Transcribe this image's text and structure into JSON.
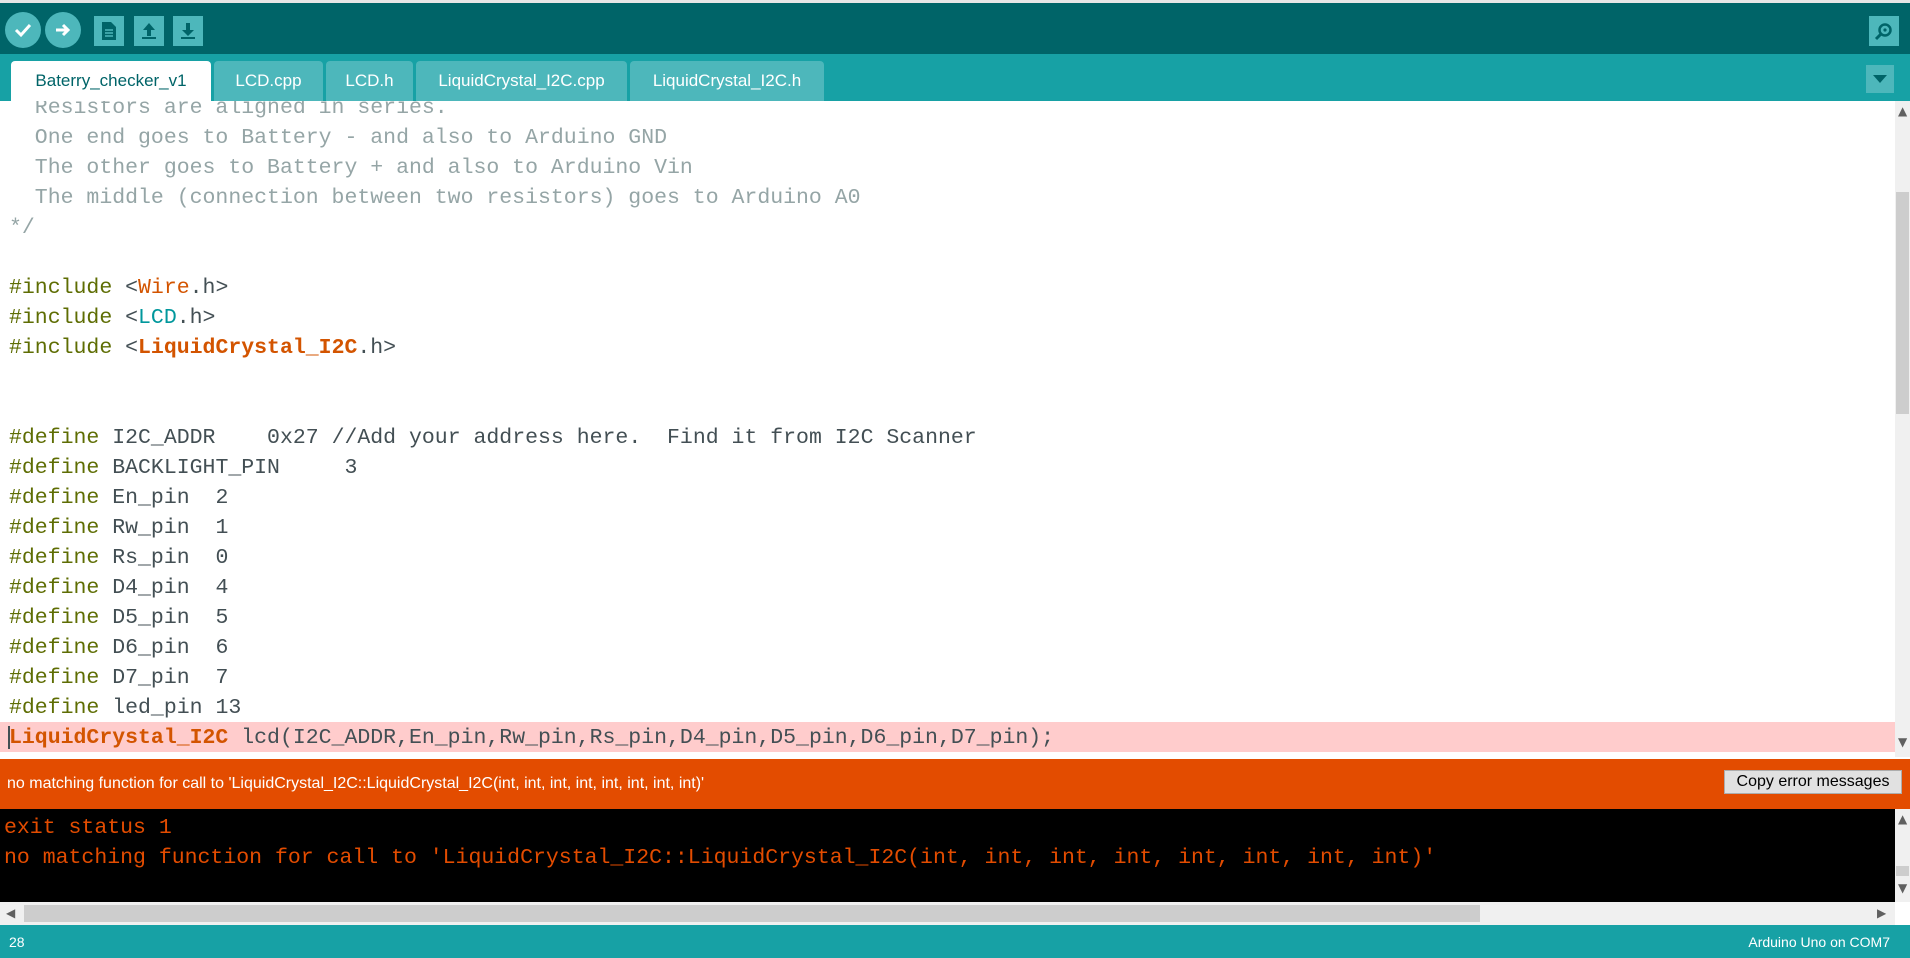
{
  "toolbar": {
    "buttons": [
      "verify-icon",
      "upload-icon",
      "new-icon",
      "open-icon",
      "save-icon",
      "serial-monitor-icon"
    ]
  },
  "tabs": [
    {
      "label": "Baterry_checker_v1",
      "active": true
    },
    {
      "label": "LCD.cpp",
      "active": false
    },
    {
      "label": "LCD.h",
      "active": false
    },
    {
      "label": "LiquidCrystal_I2C.cpp",
      "active": false
    },
    {
      "label": "LiquidCrystal_I2C.h",
      "active": false
    }
  ],
  "editor": {
    "comment": [
      "  Resistors are aligned in series.",
      "  One end goes to Battery - and also to Arduino GND",
      "  The other goes to Battery + and also to Arduino Vin",
      "  The middle (connection between two resistors) goes to Arduino A0",
      "*/"
    ],
    "include_kw": "#include",
    "includes": [
      {
        "lt": " <",
        "lib": "Wire",
        "ext": ".h>"
      },
      {
        "lt": " <",
        "lib": "LCD",
        "ext": ".h>"
      },
      {
        "lt": " <",
        "lib": "LiquidCrystal_I2C",
        "ext": ".h>"
      }
    ],
    "define_kw": "#define",
    "defines": [
      {
        "text": " I2C_ADDR    0x27 ",
        "comment": "//Add your address here.  Find it from I2C Scanner"
      },
      {
        "text": " BACKLIGHT_PIN     3",
        "comment": ""
      },
      {
        "text": " En_pin  2",
        "comment": ""
      },
      {
        "text": " Rw_pin  1",
        "comment": ""
      },
      {
        "text": " Rs_pin  0",
        "comment": ""
      },
      {
        "text": " D4_pin  4",
        "comment": ""
      },
      {
        "text": " D5_pin  5",
        "comment": ""
      },
      {
        "text": " D6_pin  6",
        "comment": ""
      },
      {
        "text": " D7_pin  7",
        "comment": ""
      },
      {
        "text": " led_pin 13",
        "comment": ""
      }
    ],
    "error_line": {
      "type": "LiquidCrystal_I2C",
      "rest": " lcd(I2C_ADDR,En_pin,Rw_pin,Rs_pin,D4_pin,D5_pin,D6_pin,D7_pin);"
    }
  },
  "error_bar": {
    "message": "no matching function for call to 'LiquidCrystal_I2C::LiquidCrystal_I2C(int, int, int, int, int, int, int, int)'",
    "copy_button": "Copy error messages"
  },
  "console": {
    "lines": [
      "exit status 1",
      "no matching function for call to 'LiquidCrystal_I2C::LiquidCrystal_I2C(int, int, int, int, int, int, int, int)'"
    ]
  },
  "status": {
    "line_number": "28",
    "board": "Arduino Uno on COM7"
  },
  "colors": {
    "toolbar": "#006468",
    "tabbar": "#17a1a5",
    "error": "#e34c00",
    "error_highlight": "#ffcccc"
  }
}
